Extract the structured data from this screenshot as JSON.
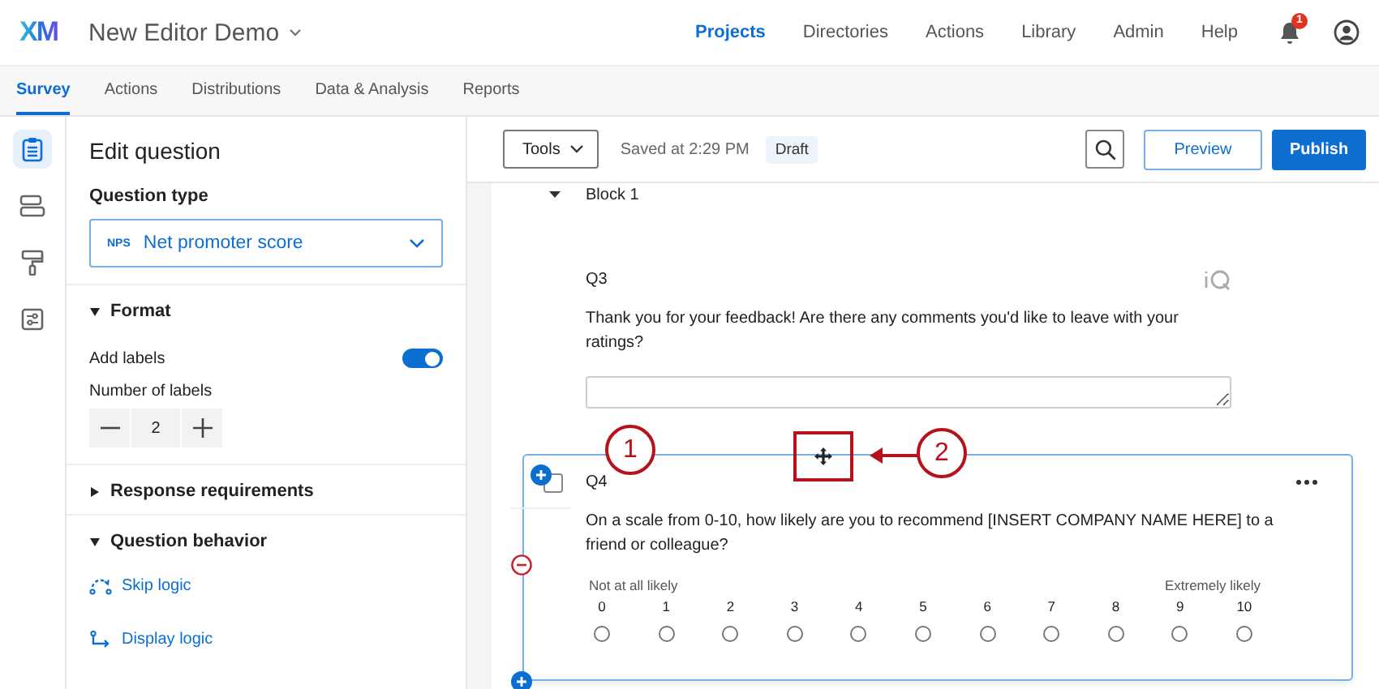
{
  "header": {
    "logo": "XM",
    "title": "New Editor Demo",
    "notifications": "1",
    "nav": [
      {
        "label": "Projects",
        "selected": true
      },
      {
        "label": "Directories",
        "selected": false
      },
      {
        "label": "Actions",
        "selected": false
      },
      {
        "label": "Library",
        "selected": false
      },
      {
        "label": "Admin",
        "selected": false
      },
      {
        "label": "Help",
        "selected": false
      }
    ]
  },
  "tabs": [
    {
      "label": "Survey",
      "selected": true
    },
    {
      "label": "Actions",
      "selected": false
    },
    {
      "label": "Distributions",
      "selected": false
    },
    {
      "label": "Data & Analysis",
      "selected": false
    },
    {
      "label": "Reports",
      "selected": false
    }
  ],
  "rail": [
    {
      "kind": "clipboard",
      "selected": true
    },
    {
      "kind": "layout",
      "selected": false
    },
    {
      "kind": "paint",
      "selected": false
    },
    {
      "kind": "options",
      "selected": false
    }
  ],
  "panel": {
    "title": "Edit question",
    "question_type": {
      "label": "Question type",
      "badge": "NPS",
      "value": "Net promoter score"
    },
    "format": {
      "title": "Format",
      "expanded": true,
      "add_labels": {
        "label": "Add labels",
        "on": true
      },
      "number_of_labels": {
        "label": "Number of labels",
        "value": "2"
      }
    },
    "response_requirements": {
      "title": "Response requirements",
      "expanded": false
    },
    "question_behavior": {
      "title": "Question behavior",
      "expanded": true,
      "links": [
        {
          "kind": "skip",
          "label": "Skip logic"
        },
        {
          "kind": "display",
          "label": "Display logic"
        }
      ]
    }
  },
  "toolbar": {
    "tools": "Tools",
    "saved": "Saved at 2:29 PM",
    "status": "Draft",
    "buttons": [
      {
        "kind": "secondary",
        "label": "Preview"
      },
      {
        "kind": "primary",
        "label": "Publish"
      }
    ]
  },
  "block": {
    "title": "Block 1",
    "expanded": true
  },
  "questions": [
    {
      "kind": "text_entry",
      "number": "Q3",
      "text": "Thank you for your feedback! Are there any comments you'd like to leave with your ratings?"
    },
    {
      "kind": "nps",
      "number": "Q4",
      "selected": true,
      "checked": false,
      "text": "On a scale from 0-10, how likely are you to recommend [INSERT COMPANY NAME HERE] to a friend or colleague?",
      "left_label": "Not at all likely",
      "right_label": "Extremely likely",
      "scale": [
        "0",
        "1",
        "2",
        "3",
        "4",
        "5",
        "6",
        "7",
        "8",
        "9",
        "10"
      ]
    }
  ],
  "annotations": [
    {
      "number": "1"
    },
    {
      "number": "2"
    }
  ]
}
